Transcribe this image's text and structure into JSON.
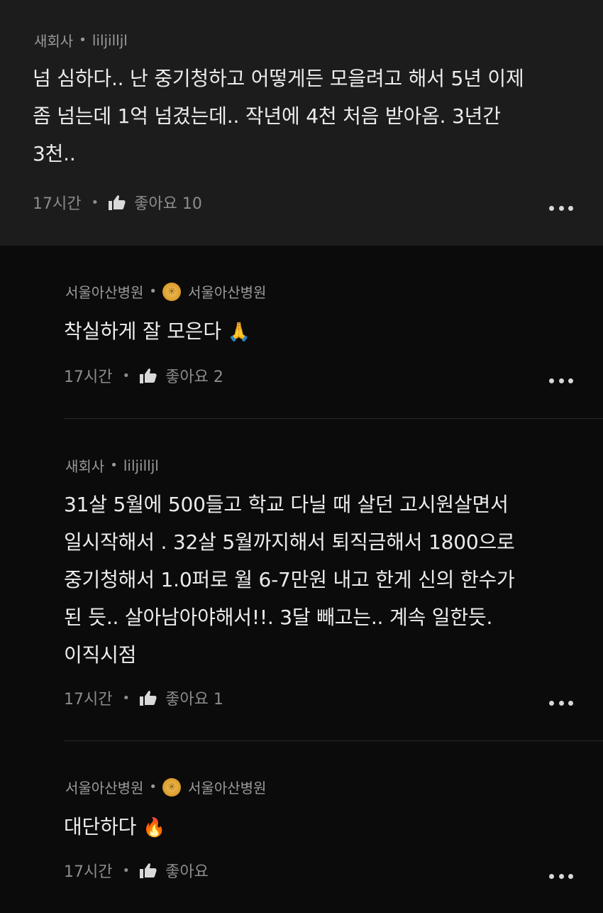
{
  "comments": [
    {
      "company": "새회사",
      "nickname": "liljilljl",
      "lines": [
        "넘 심하다.. 난 중기청하고 어떻게든 모을려고 해서 5년 이제",
        "좀 넘는데 1억 넘겼는데.. 작년에 4천 처음 받아옴. 3년간",
        "3천.."
      ],
      "time": "17시간",
      "like_label": "좋아요 10"
    },
    {
      "company": "서울아산병원",
      "nickname": "서울아산병원",
      "badge_icon": "gold-badge-icon",
      "lines": [
        "착실하게 잘 모은다"
      ],
      "emoji": "🙏",
      "time": "17시간",
      "like_label": "좋아요 2"
    },
    {
      "company": "새회사",
      "nickname": "liljilljl",
      "lines": [
        "31살 5월에 500들고 학교 다닐 때 살던 고시원살면서",
        "일시작해서 . 32살 5월까지해서 퇴직금해서 1800으로",
        "중기청해서 1.0퍼로 월 6-7만원  내고 한게 신의 한수가",
        "된 듯.. 살아남아야해서!!. 3달 빼고는.. 계속 일한듯.",
        "이직시점"
      ],
      "time": "17시간",
      "like_label": "좋아요 1"
    },
    {
      "company": "서울아산병원",
      "nickname": "서울아산병원",
      "badge_icon": "gold-badge-icon",
      "lines": [
        "대단하다"
      ],
      "emoji": "🔥",
      "time": "17시간",
      "like_label": "좋아요"
    }
  ],
  "separator_dot": "•",
  "colors": {
    "top_bg": "#1c1c1c",
    "page_bg": "#0b0b0b",
    "badge": "#e3a83c"
  }
}
